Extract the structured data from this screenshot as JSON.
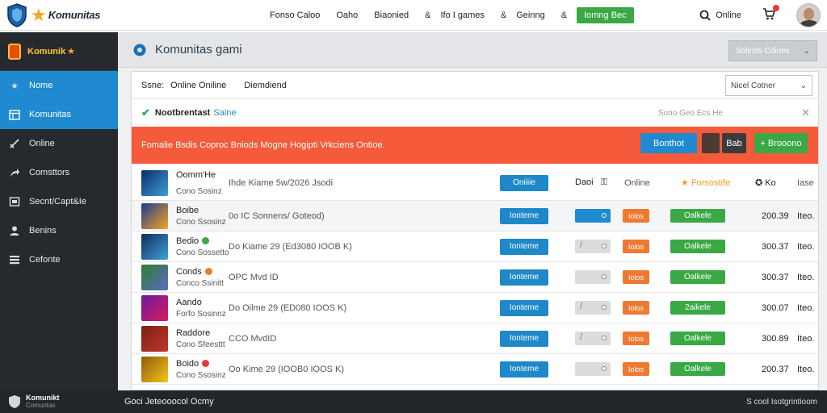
{
  "brand": {
    "name": "Komunitas"
  },
  "nav": {
    "items": [
      "Fonso Caloo",
      "Oaho",
      "Biaonied",
      "Ifo I games",
      "Geinng"
    ],
    "separators": [
      "&",
      "&",
      "&"
    ],
    "cta": "Iomng Bec"
  },
  "top": {
    "search_label": "Online"
  },
  "sidebar": {
    "brand": "Komunik",
    "items": [
      {
        "label": "Nome",
        "icon": "star-icon",
        "active": true
      },
      {
        "label": "Komunitas",
        "icon": "calendar-icon",
        "active": true
      },
      {
        "label": "Online",
        "icon": "sword-icon",
        "active": false
      },
      {
        "label": "Comsttors",
        "icon": "share-icon",
        "active": false
      },
      {
        "label": "Secnt/Capt&Ie",
        "icon": "window-icon",
        "active": false
      },
      {
        "label": "Benins",
        "icon": "user-icon",
        "active": false
      },
      {
        "label": "Cefonte",
        "icon": "list-icon",
        "active": false
      }
    ]
  },
  "main": {
    "title": "Komunitas gami",
    "header_dropdown": "Solirsts Cdines"
  },
  "filters": {
    "label1": "Ssne:",
    "label2": "Online Oniline",
    "label3": "Diemdiend",
    "select": "Nicel Cotner"
  },
  "notice": {
    "title": "Nootbrentast",
    "link": "Saine",
    "meta": "Suno Geo Ecs He"
  },
  "alert": {
    "message": "Fomalie Bsdis Coproc Bniods Mogne Hogipti Vrkciens Ontioe.",
    "btn_primary": "Bonthot",
    "btn_dark": "Bab",
    "btn_green": "Brooono"
  },
  "table": {
    "header": {
      "name": "Oomm'He",
      "sub": "Cono Sosinz",
      "desc": "Ihde Kiame 5w/2026 Jsodi",
      "button": "Oniiiie",
      "col_a": "Daoi",
      "col_b": "Online",
      "col_c": "Forsostife",
      "col_d": "Ko",
      "col_e": "Iase"
    },
    "rows": [
      {
        "name": "Boibe",
        "sub": "Cono Ssosinz",
        "desc": "0o IC Sonnens/ Goteod)",
        "btn": "Ionteme",
        "toggle": "on",
        "mark": "",
        "orange": "Iolos",
        "green": "Oalkele",
        "price": "200.39",
        "unit": "Iteo.",
        "dot": "",
        "thumb": [
          "#1b3a8c",
          "#f5a623"
        ],
        "shade": true
      },
      {
        "name": "Bedio",
        "sub": "Cono Sossetto",
        "desc": "Do Kiame 29 (Ed3080 IOOB K)",
        "btn": "Ionteme",
        "toggle": "off",
        "mark": "/",
        "orange": "Iolos",
        "green": "Oalkele",
        "price": "300.37",
        "unit": "Iteo.",
        "dot": "#3aa845",
        "thumb": [
          "#0f2d5c",
          "#3fa0d8"
        ],
        "shade": false
      },
      {
        "name": "Conds",
        "sub": "Conco Ssinitt",
        "desc": "OPC Mvd ID",
        "btn": "Ionteme",
        "toggle": "off",
        "mark": "",
        "orange": "Iolos",
        "green": "Oalkele",
        "price": "300.37",
        "unit": "Iteo.",
        "dot": "#e67e22",
        "thumb": [
          "#2e7d32",
          "#5c6bc0"
        ],
        "shade": false
      },
      {
        "name": "Aando",
        "sub": "Forfo Sosinnz",
        "desc": "Do Oilme 29 (ED080 IOOS K)",
        "btn": "Ionteme",
        "toggle": "off",
        "mark": "/",
        "orange": "Iolos",
        "green": "2aikele",
        "price": "300.07",
        "unit": "Iteo.",
        "dot": "",
        "thumb": [
          "#6a1b9a",
          "#d81b60"
        ],
        "shade": false
      },
      {
        "name": "Raddore",
        "sub": "Cono Sfeesttt",
        "desc": "CCO MvdID",
        "btn": "Ionteme",
        "toggle": "off",
        "mark": "/",
        "orange": "Iolos",
        "green": "Oalkele",
        "price": "300.89",
        "unit": "Iteo.",
        "dot": "",
        "thumb": [
          "#7b1f14",
          "#c0392b"
        ],
        "shade": false
      },
      {
        "name": "Boido",
        "sub": "Cono Ssosinz",
        "desc": "Oo Kime 29 (IOOB0 IOOS K)",
        "btn": "Ionteme",
        "toggle": "off",
        "mark": "",
        "orange": "Iolos",
        "green": "Oalkele",
        "price": "200.37",
        "unit": "Iteo.",
        "dot": "#e53935",
        "thumb": [
          "#8d5a0f",
          "#f5c518"
        ],
        "shade": false
      }
    ]
  },
  "footer": {
    "brand_line1": "Komunikt",
    "brand_line2": "Comuntas",
    "center": "Goci Jeteooocol Ocmy",
    "right": "S cool Isotgrintioom"
  },
  "colors": {
    "accent_blue": "#1f8ad0",
    "alert_orange": "#f55a3a",
    "success_green": "#3aa845",
    "sidebar_bg": "#262a2f"
  }
}
